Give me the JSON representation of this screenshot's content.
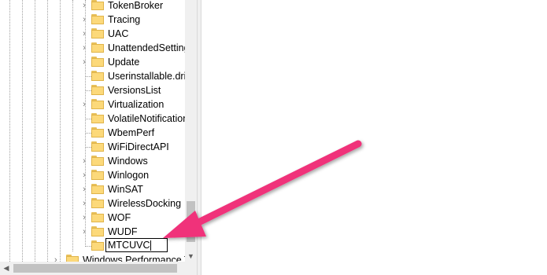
{
  "tree": {
    "items": [
      {
        "label": "TokenBroker",
        "expandable": true
      },
      {
        "label": "Tracing",
        "expandable": true
      },
      {
        "label": "UAC",
        "expandable": true
      },
      {
        "label": "UnattendedSettings",
        "expandable": true
      },
      {
        "label": "Update",
        "expandable": true
      },
      {
        "label": "Userinstallable.drivers",
        "expandable": false
      },
      {
        "label": "VersionsList",
        "expandable": false
      },
      {
        "label": "Virtualization",
        "expandable": true
      },
      {
        "label": "VolatileNotifications",
        "expandable": false
      },
      {
        "label": "WbemPerf",
        "expandable": false
      },
      {
        "label": "WiFiDirectAPI",
        "expandable": false
      },
      {
        "label": "Windows",
        "expandable": true
      },
      {
        "label": "Winlogon",
        "expandable": true
      },
      {
        "label": "WinSAT",
        "expandable": true
      },
      {
        "label": "WirelessDocking",
        "expandable": true
      },
      {
        "label": "WOF",
        "expandable": true
      },
      {
        "label": "WUDF",
        "expandable": true
      }
    ],
    "new_key_value": "MTCUVC",
    "sibling_label": "Windows Performance Toolkit"
  },
  "icons": {
    "expand": "chevron-right-icon",
    "folder": "folder-icon",
    "annotation": "pink-arrow-annotation"
  },
  "colors": {
    "folder": "#fcd97a",
    "annotation_arrow": "#f0317a"
  }
}
